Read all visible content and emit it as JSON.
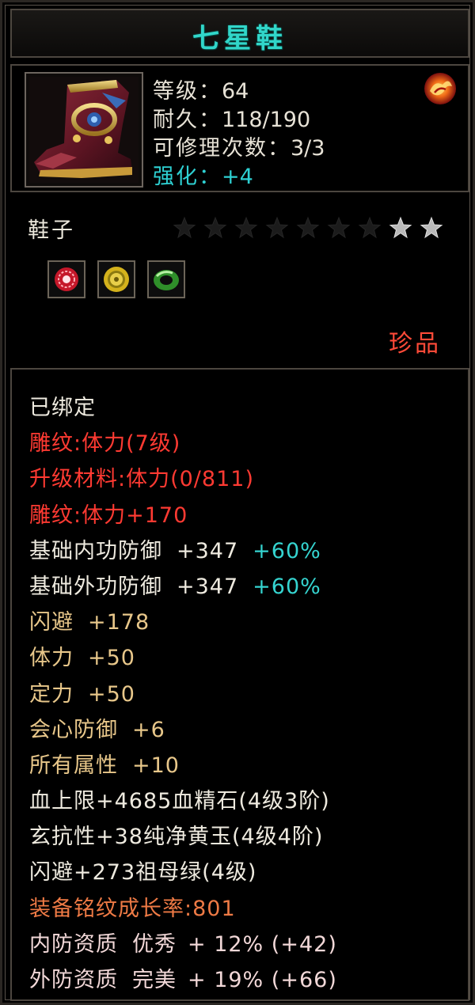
{
  "item": {
    "name": "七星鞋",
    "icon": "boot-icon",
    "stats": {
      "level_label": "等级：",
      "level_value": "64",
      "durability_label": "耐久：",
      "durability_value": "118/190",
      "repair_label": "可修理次数：",
      "repair_value": "3/3",
      "enhance_label": "强化：",
      "enhance_value": "+4"
    },
    "badge_icon": "flame-orb-icon",
    "type": "鞋子",
    "stars": {
      "total": 9,
      "filled": 2
    },
    "gems": [
      {
        "icon": "red-gem-icon",
        "color": "#d82030"
      },
      {
        "icon": "gold-coin-icon",
        "color": "#d6b020"
      },
      {
        "icon": "jade-ring-icon",
        "color": "#3fae3a"
      }
    ],
    "rarity": "珍品"
  },
  "details": {
    "bound": "已绑定",
    "engrave": "雕纹:体力(7级)",
    "upgrade_material": "升级材料:体力(0/811)",
    "engrave_bonus": "雕纹:体力+170",
    "base_inner_def_label": "基础内功防御",
    "base_inner_def_value": "+347",
    "base_inner_def_pct": "+60%",
    "base_outer_def_label": "基础外功防御",
    "base_outer_def_value": "+347",
    "base_outer_def_pct": "+60%",
    "dodge_label": "闪避",
    "dodge_value": "+178",
    "stamina_label": "体力",
    "stamina_value": "+50",
    "focus_label": "定力",
    "focus_value": "+50",
    "crit_def_label": "会心防御",
    "crit_def_value": "+6",
    "all_attr_label": "所有属性",
    "all_attr_value": "+10",
    "gem_line_1": "血上限+4685血精石(4级3阶)",
    "gem_line_2": "玄抗性+38纯净黄玉(4级4阶)",
    "gem_line_3": "闪避+273祖母绿(4级)",
    "growth": "装备铭纹成长率:801",
    "inner_quality_label": "内防资质",
    "inner_quality_grade": "优秀",
    "inner_quality_value": "+ 12% (+42)",
    "outer_quality_label": "外防资质",
    "outer_quality_grade": "完美",
    "outer_quality_value": "+ 19% (+66)"
  }
}
